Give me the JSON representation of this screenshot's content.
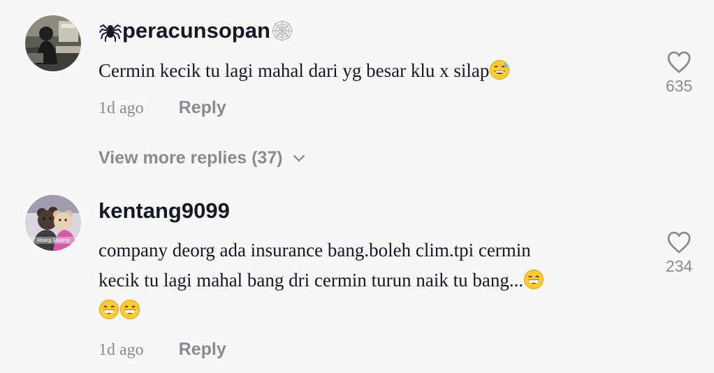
{
  "comments": [
    {
      "username": "peracunsopan",
      "username_prefix_icon": "spider-icon",
      "username_suffix_icon": "spider-web-icon",
      "text": "Cermin kecik tu lagi mahal dari yg besar klu x silap",
      "text_emojis": [
        "grinning-sweat-emoji"
      ],
      "time": "1d ago",
      "reply_label": "Reply",
      "likes": "635",
      "avatar_icon": "person-at-desk-avatar"
    },
    {
      "username": "kentang9099",
      "text_line1": "company deorg ada insurance bang.boleh clim.tpi cermin",
      "text_line2": "kecik tu lagi mahal bang dri cermin turun naik tu bang...",
      "text_emojis": [
        "beaming-face-emoji",
        "beaming-face-emoji",
        "beaming-face-emoji"
      ],
      "time": "1d ago",
      "reply_label": "Reply",
      "likes": "234",
      "avatar_icon": "teddy-bears-avatar",
      "avatar_caption": "Abang Sayang"
    }
  ],
  "view_more": {
    "label": "View more replies (37)",
    "icon": "chevron-down-icon"
  },
  "like_icon": "heart-outline-icon",
  "colors": {
    "background": "#f7f7f7",
    "text": "#161823",
    "muted": "#8a8b91"
  }
}
